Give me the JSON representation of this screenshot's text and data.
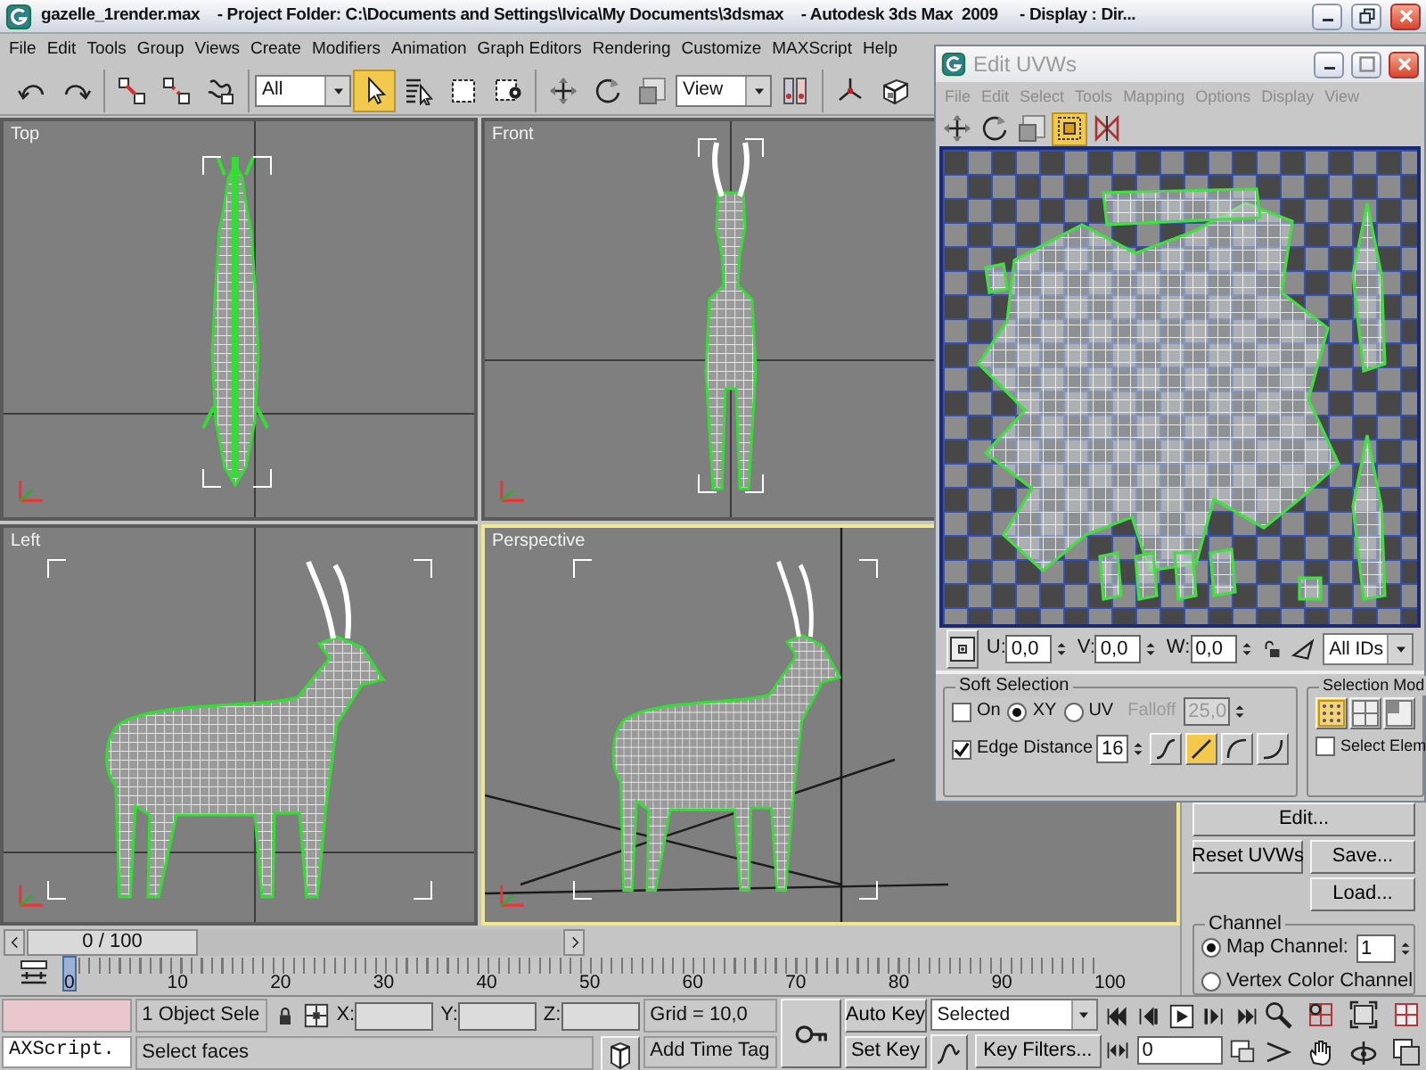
{
  "window": {
    "title": "gazelle_1render.max    - Project Folder: C:\\Documents and Settings\\Ivica\\My Documents\\3dsmax    - Autodesk 3ds Max  2009     - Display : Dir..."
  },
  "menu": [
    "File",
    "Edit",
    "Tools",
    "Group",
    "Views",
    "Create",
    "Modifiers",
    "Animation",
    "Graph Editors",
    "Rendering",
    "Customize",
    "MAXScript",
    "Help"
  ],
  "toolbar_groups": [
    {
      "items": [
        {
          "kind": "tool",
          "selected": false
        },
        {
          "kind": "tool",
          "selected": false
        }
      ]
    },
    {
      "items": [
        {
          "kind": "tool",
          "selected": false
        },
        {
          "kind": "tool",
          "selected": false
        },
        {
          "kind": "tool",
          "selected": false
        }
      ]
    },
    {
      "items": [
        {
          "kind": "dropdown",
          "value": "All"
        },
        {
          "kind": "tool",
          "selected": true
        },
        {
          "kind": "tool",
          "selected": false
        },
        {
          "kind": "tool",
          "selected": false
        },
        {
          "kind": "tool",
          "selected": false
        }
      ]
    },
    {
      "items": [
        {
          "kind": "tool",
          "selected": false
        },
        {
          "kind": "tool",
          "selected": false
        },
        {
          "kind": "tool",
          "selected": false
        },
        {
          "kind": "dropdown",
          "value": "View"
        },
        {
          "kind": "tool",
          "selected": false
        }
      ]
    },
    {
      "items": [
        {
          "kind": "tool",
          "selected": false
        },
        {
          "kind": "tool",
          "selected": false
        }
      ]
    }
  ],
  "viewports": [
    {
      "label": "Top",
      "kind": "top",
      "active": false
    },
    {
      "label": "Front",
      "kind": "front",
      "active": false
    },
    {
      "label": "Left",
      "kind": "side",
      "active": false
    },
    {
      "label": "Perspective",
      "kind": "perspective",
      "active": true
    }
  ],
  "uvw_editor": {
    "title": "Edit UVWs",
    "menu": [
      "File",
      "Edit",
      "Select",
      "Tools",
      "Mapping",
      "Options",
      "Display",
      "View"
    ],
    "tools": [
      {
        "selected": false
      },
      {
        "selected": false
      },
      {
        "selected": false
      },
      {
        "selected": true
      },
      {
        "selected": false
      }
    ],
    "coords": [
      {
        "label": "U:",
        "value": "0,0"
      },
      {
        "label": "V:",
        "value": "0,0"
      },
      {
        "label": "W:",
        "value": "0,0"
      }
    ],
    "id_filter": "All IDs",
    "soft_selection": {
      "title": "Soft Selection",
      "on": {
        "label": "On",
        "checked": false
      },
      "modes": [
        {
          "label": "XY",
          "selected": true
        },
        {
          "label": "UV",
          "selected": false
        }
      ],
      "falloff": {
        "label": "Falloff",
        "value": "25,0",
        "disabled": true
      },
      "edge_distance": {
        "label": "Edge Distance",
        "checked": true,
        "value": "16"
      },
      "curves": [
        {
          "selected": false
        },
        {
          "selected": true
        },
        {
          "selected": false
        },
        {
          "selected": false
        }
      ]
    },
    "selection_modes": {
      "title": "Selection Mod",
      "buttons": [
        {
          "selected": true
        },
        {
          "selected": false
        },
        {
          "selected": false
        }
      ],
      "select_element": {
        "label": "Select Elem",
        "checked": false
      }
    }
  },
  "command_panel": {
    "buttons": [
      "Edit...",
      "Reset UVWs",
      "Save...",
      "Load..."
    ],
    "channel": {
      "title": "Channel",
      "options": [
        {
          "label": "Map Channel:",
          "selected": true,
          "value": "1"
        },
        {
          "label": "Vertex Color Channel",
          "selected": false
        }
      ]
    }
  },
  "time_slider": {
    "position": "0 / 100",
    "level": 0
  },
  "track_bar": {
    "labels": [
      "0",
      "10",
      "20",
      "30",
      "40",
      "50",
      "60",
      "70",
      "80",
      "90",
      "100"
    ]
  },
  "status": {
    "listener": "AXScript.",
    "selection": "1 Object Sele",
    "coords": [
      {
        "label": "X:"
      },
      {
        "label": "Y:"
      },
      {
        "label": "Z:"
      }
    ],
    "grid": "Grid = 10,0",
    "prompt": "Select faces",
    "time_tag": "Add Time Tag",
    "auto_key": "Auto Key",
    "set_key": "Set Key",
    "key_mode": "Selected",
    "key_filters": "Key Filters...",
    "frame": "0"
  }
}
